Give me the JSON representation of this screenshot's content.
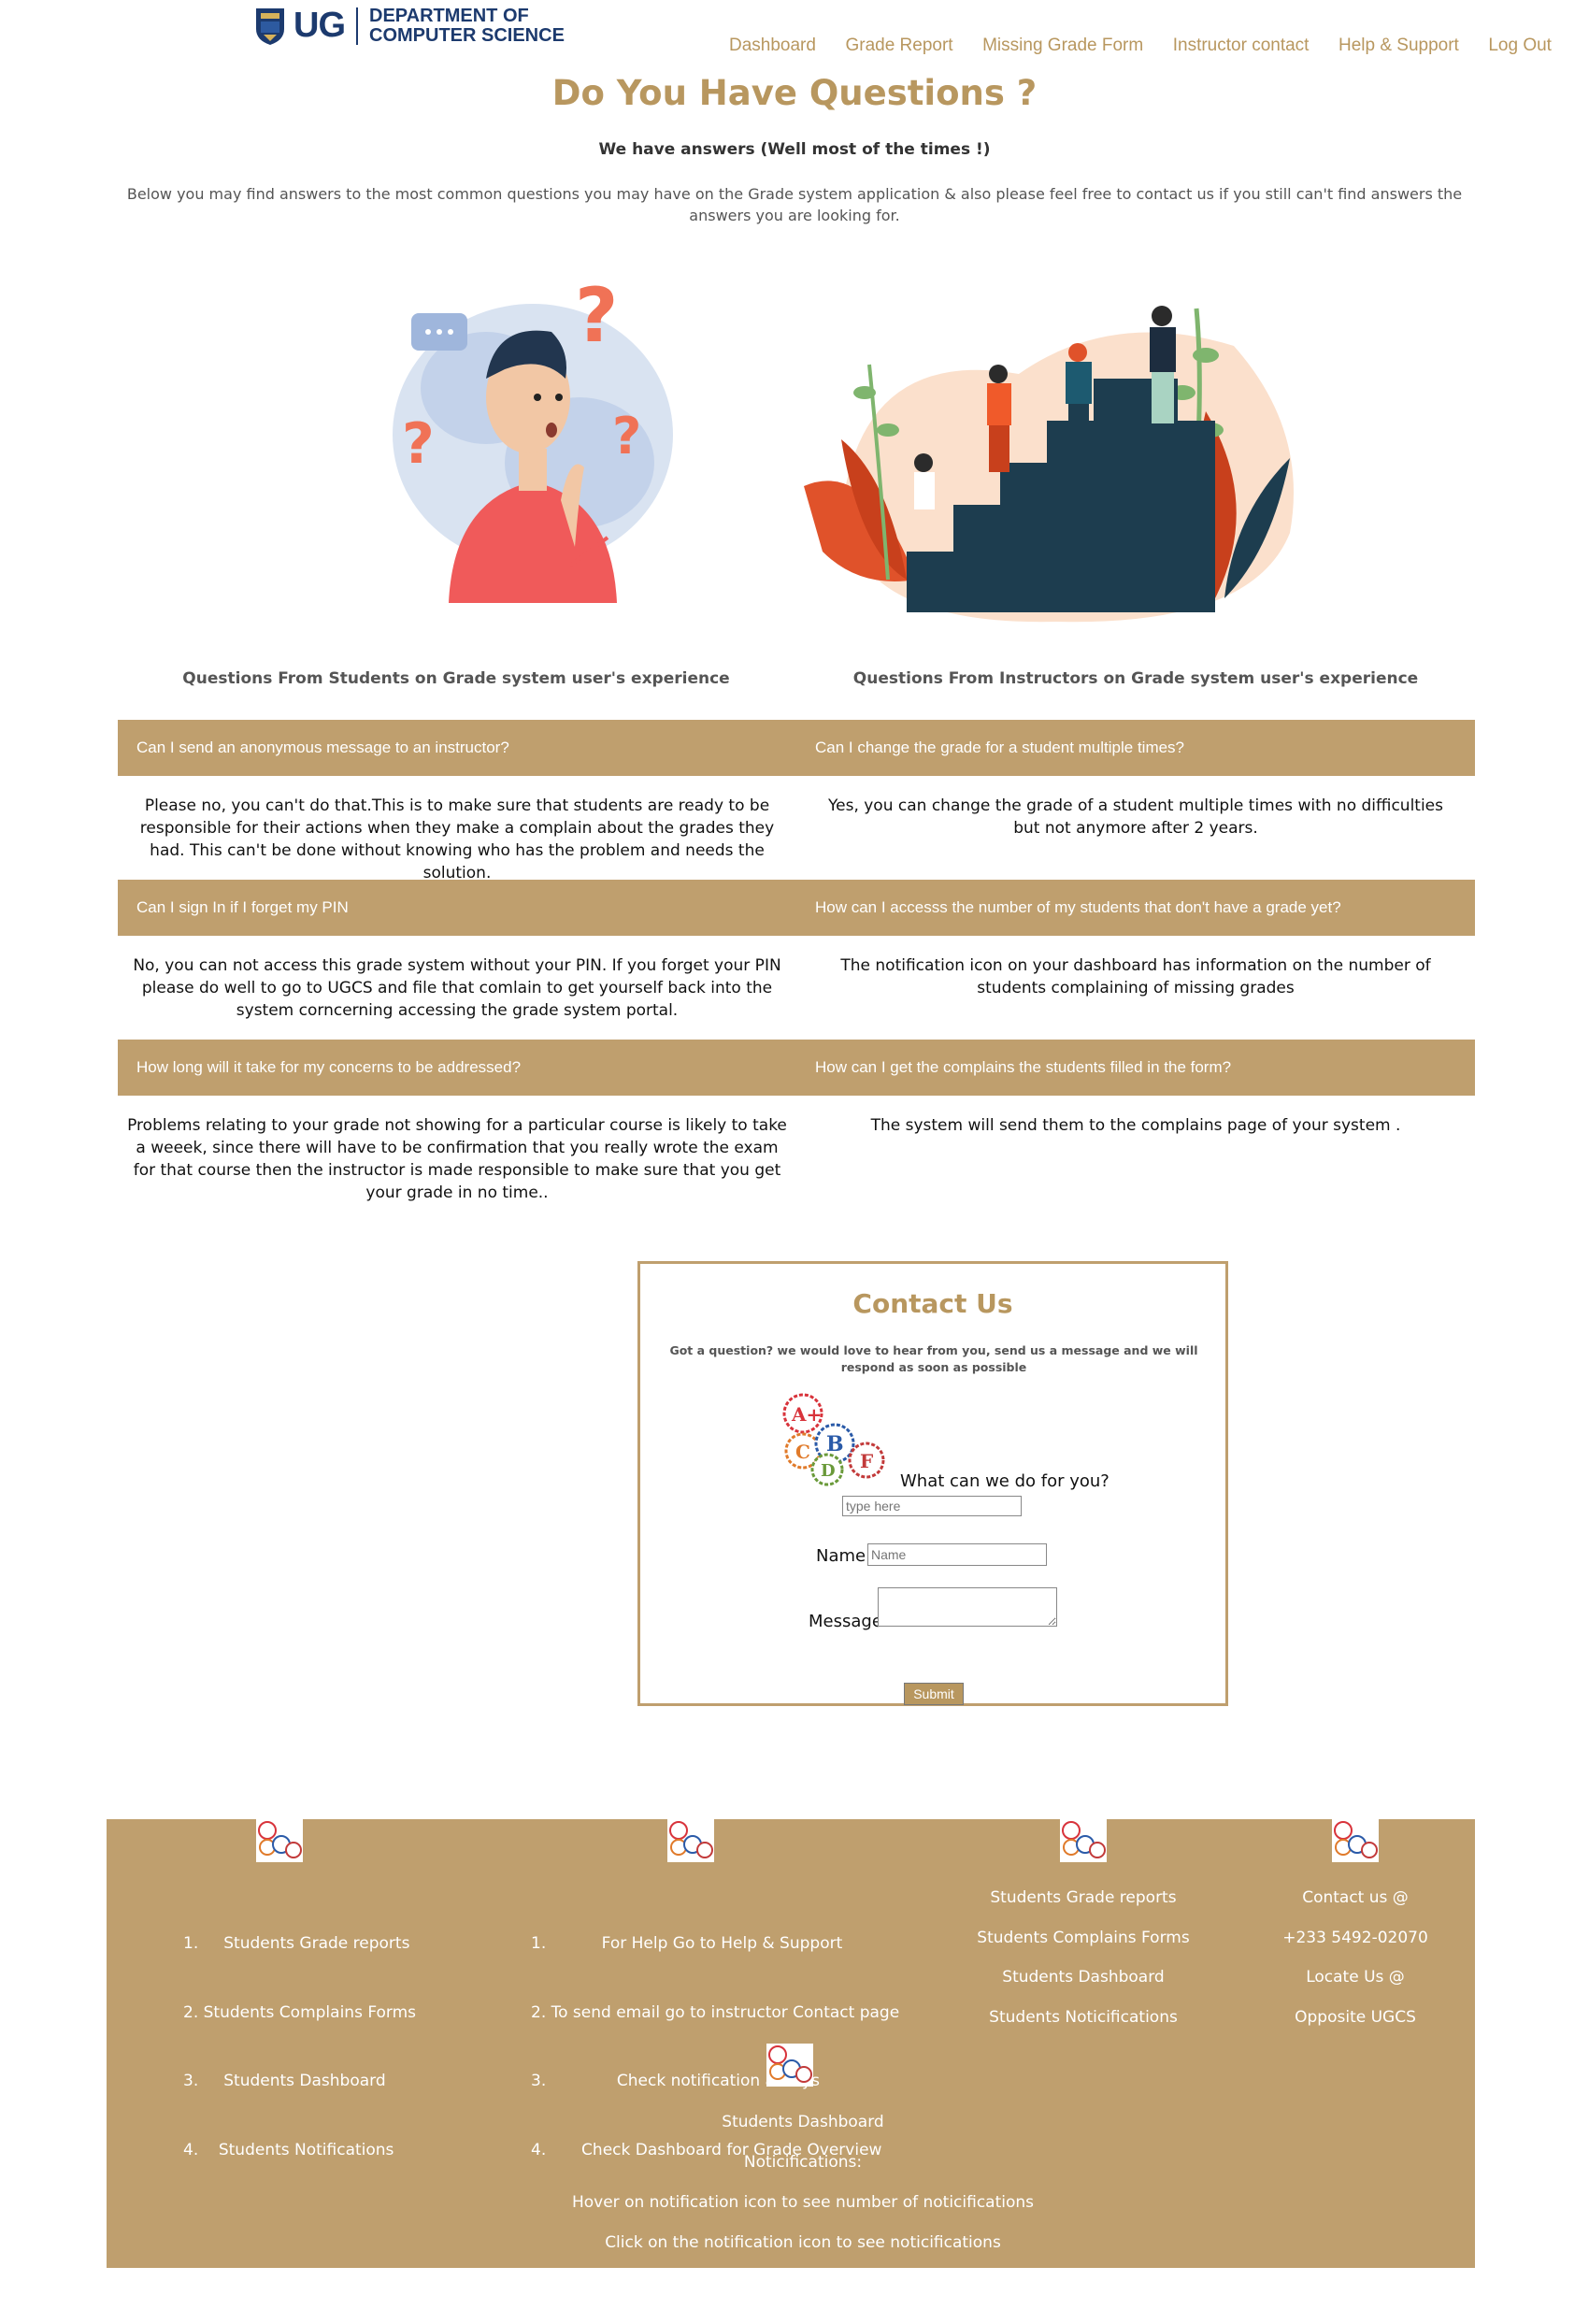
{
  "header": {
    "logo_short": "UG",
    "logo_line1": "DEPARTMENT OF",
    "logo_line2": "COMPUTER SCIENCE",
    "nav": [
      "Dashboard",
      "Grade Report",
      "Missing Grade Form",
      "Instructor contact",
      "Help & Support",
      "Log Out"
    ]
  },
  "page": {
    "title": "Do You Have Questions ?",
    "subtitle": "We have answers (Well most of the times !)",
    "intro": "Below you may find answers to the most common questions you may have on the Grade system application & also please feel free to contact us if you still can't find answers the answers you are looking for."
  },
  "columns": {
    "students": "Questions From Students on Grade system user's experience",
    "instructors": "Questions From Instructors on Grade system user's experience"
  },
  "faq": [
    {
      "q1": "Can I send an anonymous message to an instructor?",
      "q2": "Can I change the grade for a student multiple times?",
      "a1": "Please no, you can't do that.This is to make sure that students are ready to be responsible for their actions when they make a complain about the grades they had. This can't be done without knowing who has the problem and needs the solution.",
      "a2": "Yes, you can change the grade of a student multiple times with no difficulties but not anymore after 2 years."
    },
    {
      "q1": "Can I sign In if I forget my PIN",
      "q2": "How can I accesss the number of my students that don't have a grade yet?",
      "a1": "No, you can not access this grade system without your PIN. If you forget your PIN please do well to go to UGCS and file that comlain to get yourself back into the system corncerning accessing the grade system portal.",
      "a2": "The notification icon on your dashboard has information on the number of students complaining of missing grades"
    },
    {
      "q1": "How long will it take for my concerns to be addressed?",
      "q2": "How can I get the complains the students filled in the form?",
      "a1": "Problems relating to your grade not showing for a particular course is likely to take a weeek, since there will have to be confirmation that you really wrote the exam for that course then the instructor is made responsible to make sure that you get your grade in no time..",
      "a2": "The system will send them to the complains page of your system ."
    }
  ],
  "contact": {
    "title": "Contact Us",
    "subtitle": "Got a question? we would love to hear from you, send us a message and we will respond as soon as possible",
    "help_label": "What can we do for you?",
    "help_placeholder": "type here",
    "name_label": "Name:",
    "name_placeholder": "Name",
    "message_label": "Message:",
    "submit": "Submit"
  },
  "footer": {
    "list1": [
      "1.     Students Grade reports",
      "2. Students Complains Forms",
      "3.     Students Dashboard",
      "4.    Students Notifications"
    ],
    "list2": [
      "1.           For Help Go to Help & Support",
      "2. To send email go to instructor Contact page",
      "3.              Check notification always",
      "4.       Check Dashboard for Grade Overview"
    ],
    "col3": [
      "Students Grade reports",
      "Students Complains Forms",
      "Students Dashboard",
      "Students Noticifications"
    ],
    "col4": [
      "Contact us @",
      "+233 5492-02070",
      "Locate Us @",
      "Opposite UGCS"
    ],
    "bottom": [
      "Students Dashboard",
      "Noticifications:",
      "Hover on notification icon to see number of noticifications",
      "Click on the notification icon to see noticifications"
    ]
  },
  "colors": {
    "accent": "#bf9f6e",
    "logo_blue": "#1c3a6e"
  }
}
